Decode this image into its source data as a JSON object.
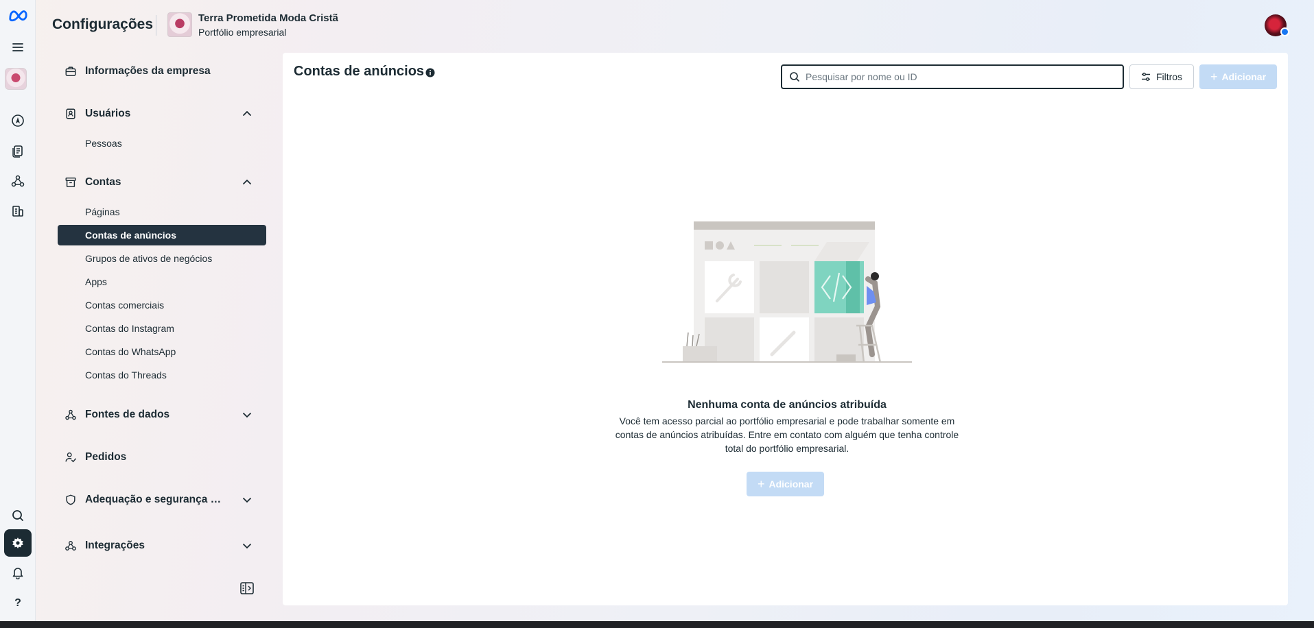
{
  "header": {
    "title": "Configurações",
    "business_name": "Terra Prometida Moda Cristã",
    "business_subtitle": "Portfólio empresarial"
  },
  "rail": {
    "icons": [
      "meta-logo-icon",
      "menu-icon",
      "business-avatar",
      "compass-icon",
      "documents-icon",
      "network-icon",
      "billing-icon",
      "search-icon",
      "gear-icon",
      "bell-icon",
      "help-icon"
    ],
    "help_label": "?"
  },
  "sidebar": {
    "company_info": "Informações da empresa",
    "users": {
      "label": "Usuários",
      "items": [
        "Pessoas"
      ]
    },
    "accounts": {
      "label": "Contas",
      "items": [
        "Páginas",
        "Contas de anúncios",
        "Grupos de ativos de negócios",
        "Apps",
        "Contas comerciais",
        "Contas do Instagram",
        "Contas do WhatsApp",
        "Contas do Threads"
      ],
      "active": "Contas de anúncios"
    },
    "data_sources": "Fontes de dados",
    "requests": "Pedidos",
    "brand_safety": "Adequação e segurança para a marca",
    "integrations": "Integrações"
  },
  "main": {
    "title": "Contas de anúncios",
    "search_placeholder": "Pesquisar por nome ou ID",
    "filters_label": "Filtros",
    "add_label": "Adicionar",
    "empty_title": "Nenhuma conta de anúncios atribuída",
    "empty_body": "Você tem acesso parcial ao portfólio empresarial e pode trabalhar somente em contas de anúncios atribuídas. Entre em contato com alguém que tenha controle total do portfólio empresarial."
  },
  "colors": {
    "active_bg": "#243340",
    "primary_disabled": "#c3dbf5",
    "text": "#1c2b33",
    "illustration_teal": "#7fd4c0"
  }
}
